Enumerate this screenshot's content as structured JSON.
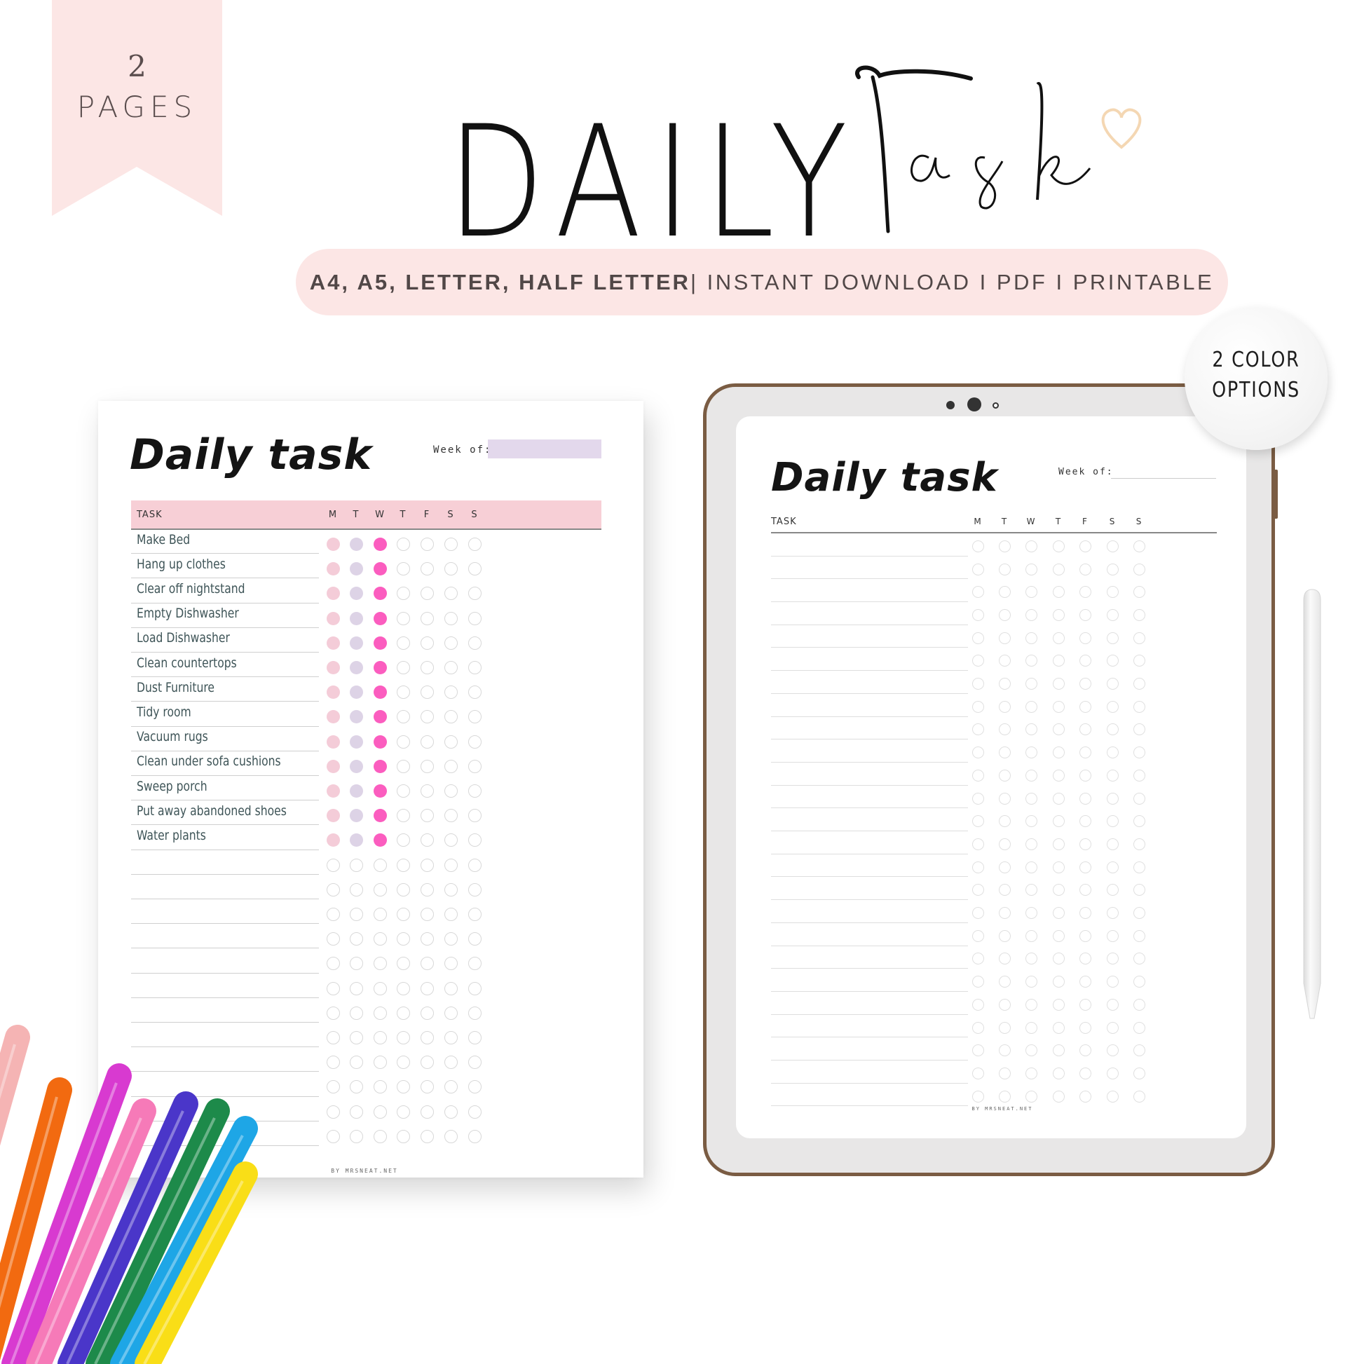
{
  "ribbon": {
    "count": "2",
    "label": "PAGES",
    "color": "#fce6e5"
  },
  "headline": {
    "word1": "DAILY",
    "word2": "Task"
  },
  "banner": {
    "bold_part": "A4, A5, LETTER, HALF LETTER",
    "light_part": "| INSTANT DOWNLOAD I PDF I PRINTABLE",
    "color": "#fce6e5"
  },
  "badge": {
    "line1": "2 COLOR",
    "line2": "OPTIONS"
  },
  "colored_planner": {
    "title": "Daily task",
    "week_label": "Week of:",
    "header_task": "TASK",
    "days": [
      "M",
      "T",
      "W",
      "T",
      "F",
      "S",
      "S"
    ],
    "header_color": "#f7cfd6",
    "week_box_color": "#e3d8ec",
    "check_colors": {
      "M": "#f4ccd8",
      "T": "#ddd3e6",
      "W": "#fb5dbf"
    },
    "completed_days_per_task": 3,
    "tasks": [
      "Make Bed",
      "Hang up clothes",
      "Clear off nightstand",
      "Empty Dishwasher",
      "Load Dishwasher",
      "Clean countertops",
      "Dust Furniture",
      "Tidy room",
      "Vacuum rugs",
      "Clean under sofa cushions",
      "Sweep porch",
      "Put away abandoned shoes",
      "Water plants"
    ],
    "total_rows": 25,
    "footer": "BY MRSNEAT.NET"
  },
  "tablet_planner": {
    "title": "Daily task",
    "week_label": "Week of:",
    "header_task": "TASK",
    "days": [
      "M",
      "T",
      "W",
      "T",
      "F",
      "S",
      "S"
    ],
    "total_rows": 25,
    "footer": "BY MRSNEAT.NET",
    "frame_color": "#7a5c43"
  },
  "markers": [
    "#f5b4b4",
    "#f26a10",
    "#d83ad0",
    "#f67ab8",
    "#4a36c9",
    "#1d8a4a",
    "#1ea6e6",
    "#f9de17"
  ]
}
